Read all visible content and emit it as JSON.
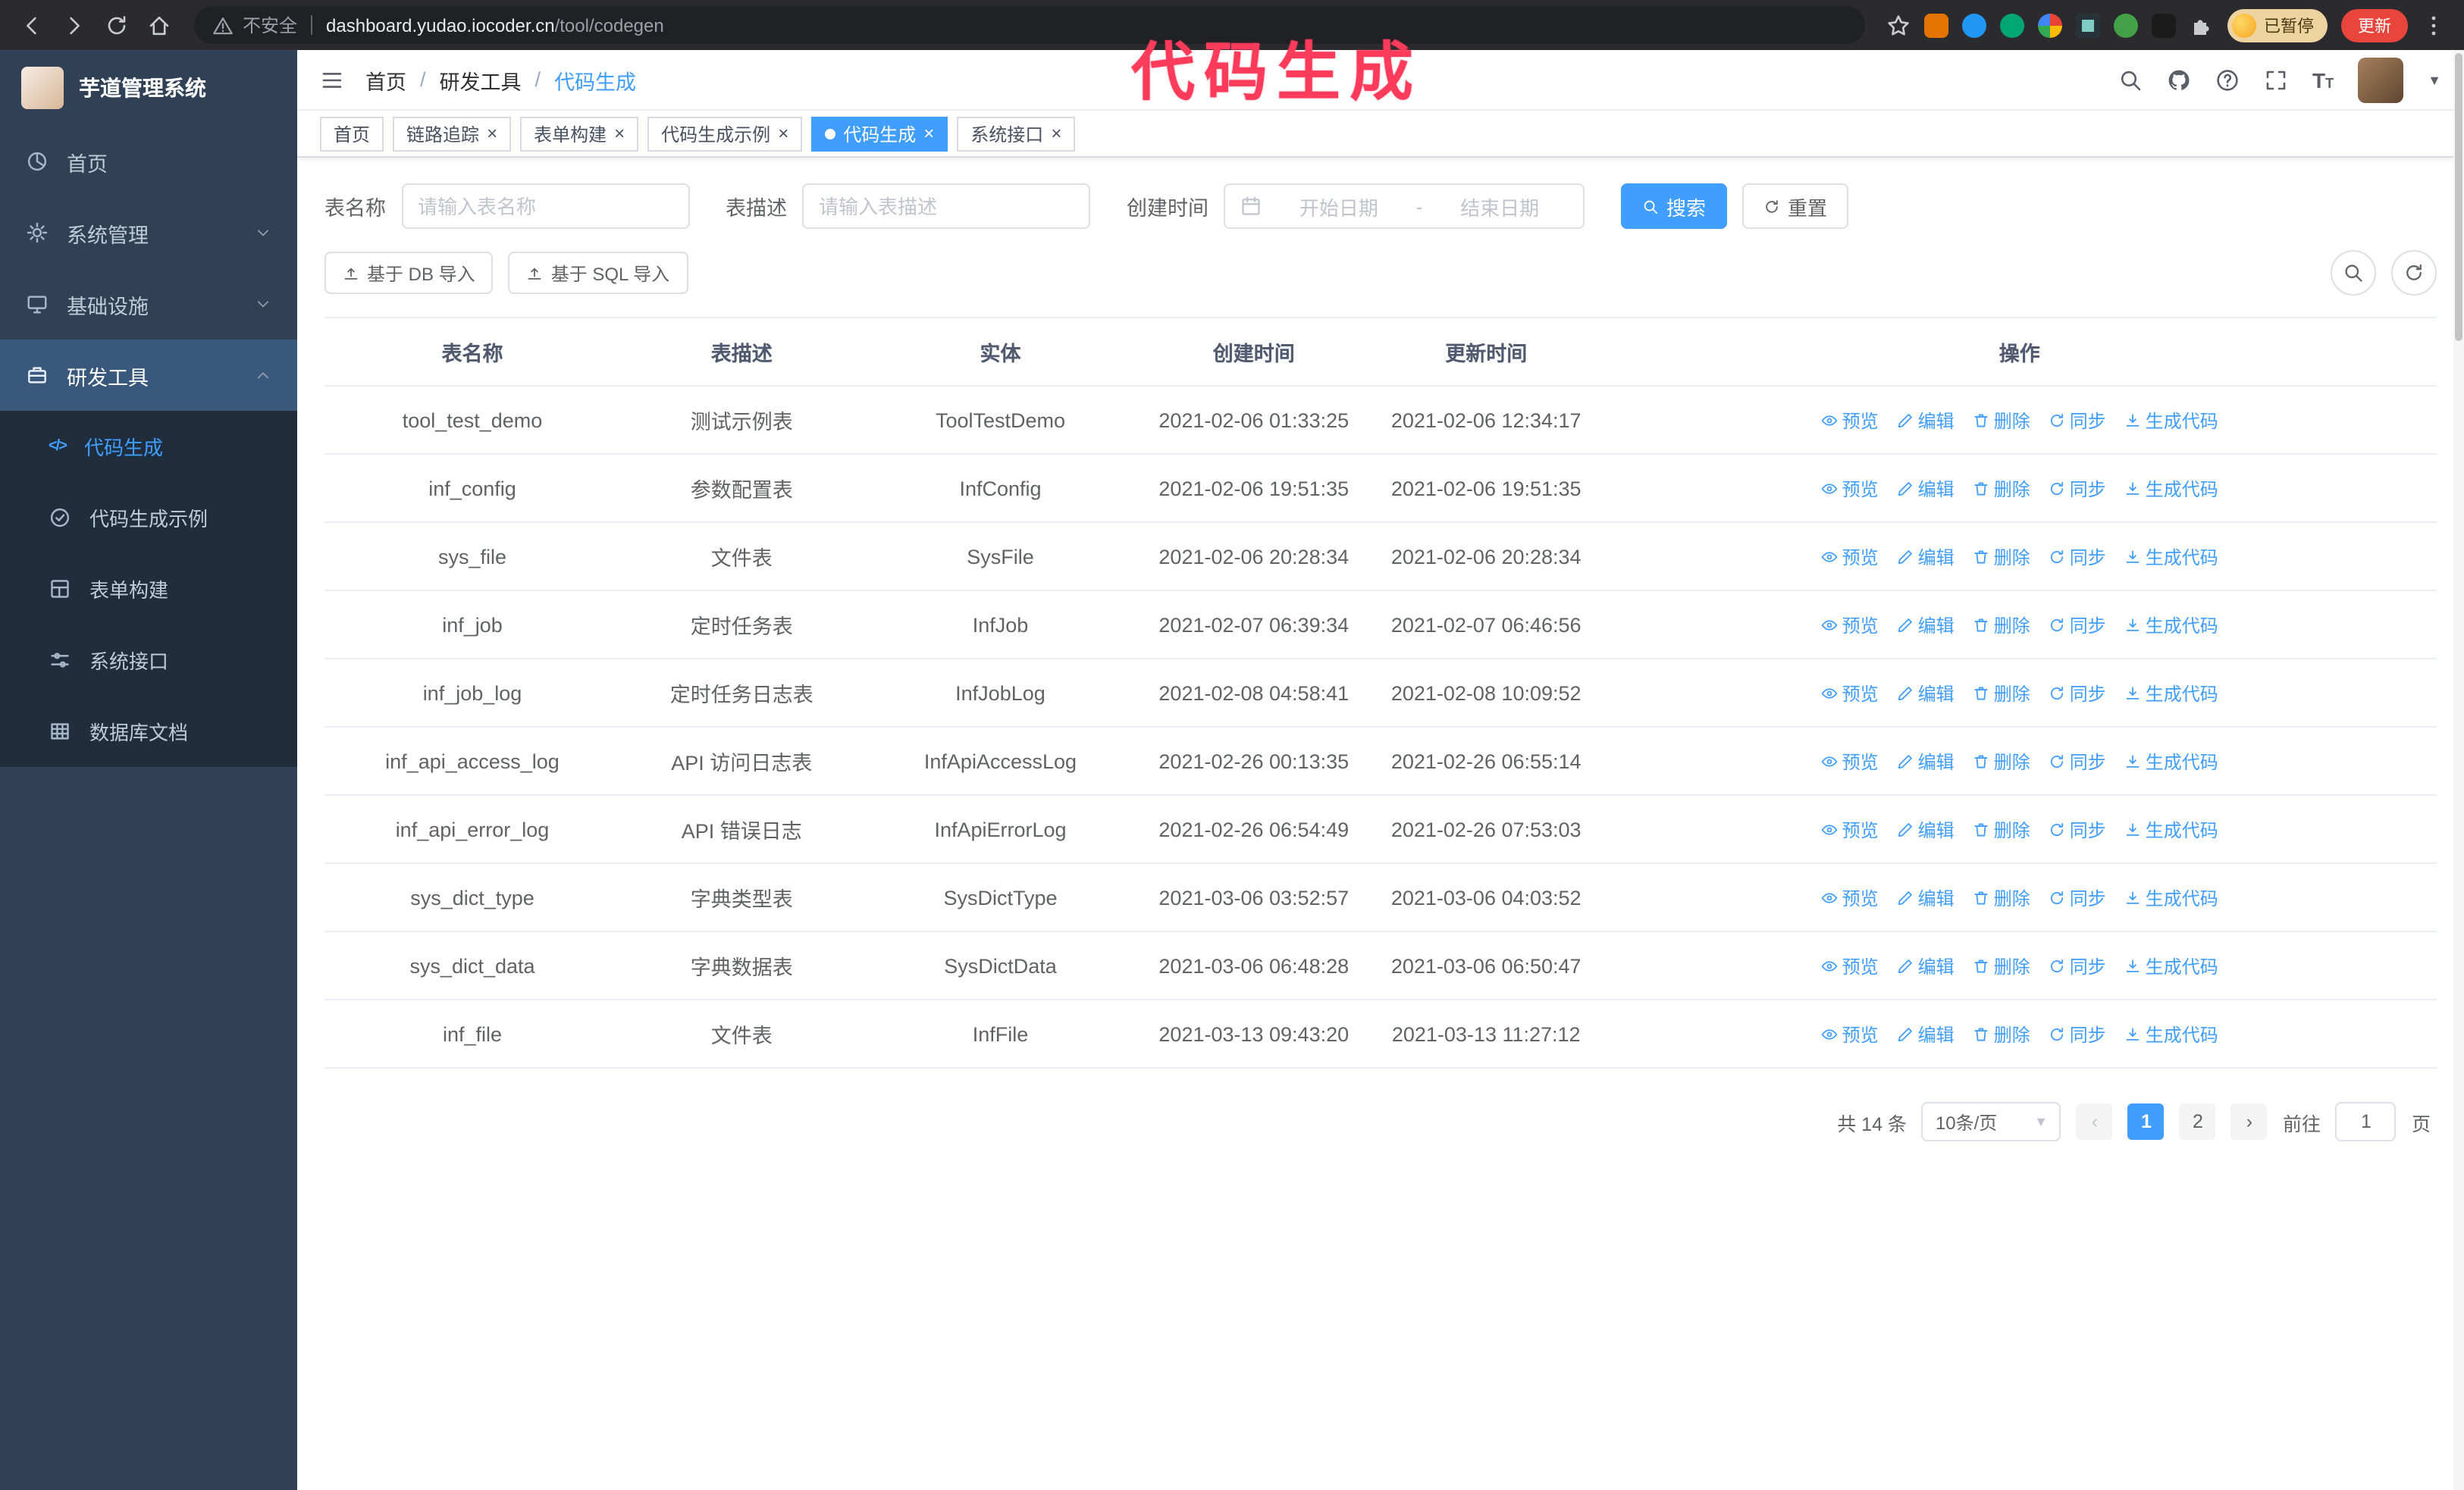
{
  "colors": {
    "accent": "#409eff",
    "annotation": "#ff3b5c",
    "sidebar": "#304156",
    "sidebar-sub": "#1f2d3d",
    "update": "#e8453c"
  },
  "annotation": {
    "text": "代码生成"
  },
  "browser": {
    "security_label": "不安全",
    "url_host": "dashboard.yudao.iocoder.cn",
    "url_path": "/tool/codegen",
    "paused_badge": "已暂停",
    "update_button": "更新"
  },
  "sidebar": {
    "app_title": "芋道管理系统",
    "items": [
      {
        "label": "首页"
      },
      {
        "label": "系统管理"
      },
      {
        "label": "基础设施"
      },
      {
        "label": "研发工具",
        "children": [
          {
            "label": "代码生成"
          },
          {
            "label": "代码生成示例"
          },
          {
            "label": "表单构建"
          },
          {
            "label": "系统接口"
          },
          {
            "label": "数据库文档"
          }
        ]
      }
    ]
  },
  "header": {
    "breadcrumb": [
      "首页",
      "研发工具",
      "代码生成"
    ]
  },
  "tabs": {
    "items": [
      "首页",
      "链路追踪",
      "表单构建",
      "代码生成示例",
      "代码生成",
      "系统接口"
    ],
    "active": "代码生成"
  },
  "filters": {
    "name_label": "表名称",
    "name_placeholder": "请输入表名称",
    "desc_label": "表描述",
    "desc_placeholder": "请输入表描述",
    "time_label": "创建时间",
    "start_placeholder": "开始日期",
    "range_separator": "-",
    "end_placeholder": "结束日期",
    "search_button": "搜索",
    "reset_button": "重置"
  },
  "toolbar": {
    "import_db": "基于 DB 导入",
    "import_sql": "基于 SQL 导入"
  },
  "table": {
    "columns": [
      "表名称",
      "表描述",
      "实体",
      "创建时间",
      "更新时间",
      "操作"
    ],
    "actions": [
      {
        "name": "preview",
        "label": "预览",
        "icon": "eye-icon"
      },
      {
        "name": "edit",
        "label": "编辑",
        "icon": "edit-icon"
      },
      {
        "name": "delete",
        "label": "删除",
        "icon": "delete-icon"
      },
      {
        "name": "sync",
        "label": "同步",
        "icon": "sync-icon"
      },
      {
        "name": "generate",
        "label": "生成代码",
        "icon": "download-icon"
      }
    ],
    "rows": [
      {
        "name": "tool_test_demo",
        "desc": "测试示例表",
        "entity": "ToolTestDemo",
        "created": "2021-02-06 01:33:25",
        "updated": "2021-02-06 12:34:17"
      },
      {
        "name": "inf_config",
        "desc": "参数配置表",
        "entity": "InfConfig",
        "created": "2021-02-06 19:51:35",
        "updated": "2021-02-06 19:51:35"
      },
      {
        "name": "sys_file",
        "desc": "文件表",
        "entity": "SysFile",
        "created": "2021-02-06 20:28:34",
        "updated": "2021-02-06 20:28:34"
      },
      {
        "name": "inf_job",
        "desc": "定时任务表",
        "entity": "InfJob",
        "created": "2021-02-07 06:39:34",
        "updated": "2021-02-07 06:46:56"
      },
      {
        "name": "inf_job_log",
        "desc": "定时任务日志表",
        "entity": "InfJobLog",
        "created": "2021-02-08 04:58:41",
        "updated": "2021-02-08 10:09:52"
      },
      {
        "name": "inf_api_access_log",
        "desc": "API 访问日志表",
        "entity": "InfApiAccessLog",
        "created": "2021-02-26 00:13:35",
        "updated": "2021-02-26 06:55:14"
      },
      {
        "name": "inf_api_error_log",
        "desc": "API 错误日志",
        "entity": "InfApiErrorLog",
        "created": "2021-02-26 06:54:49",
        "updated": "2021-02-26 07:53:03"
      },
      {
        "name": "sys_dict_type",
        "desc": "字典类型表",
        "entity": "SysDictType",
        "created": "2021-03-06 03:52:57",
        "updated": "2021-03-06 04:03:52"
      },
      {
        "name": "sys_dict_data",
        "desc": "字典数据表",
        "entity": "SysDictData",
        "created": "2021-03-06 06:48:28",
        "updated": "2021-03-06 06:50:47"
      },
      {
        "name": "inf_file",
        "desc": "文件表",
        "entity": "InfFile",
        "created": "2021-03-13 09:43:20",
        "updated": "2021-03-13 11:27:12"
      }
    ]
  },
  "pagination": {
    "total": "共 14 条",
    "page_size": "10条/页",
    "pages": [
      "1",
      "2"
    ],
    "current": "1",
    "jump_label": "前往",
    "jump_value": "1",
    "jump_unit": "页"
  }
}
